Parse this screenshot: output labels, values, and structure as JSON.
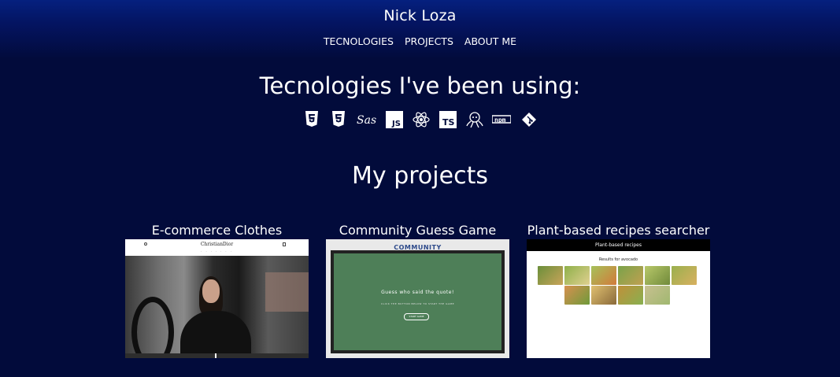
{
  "header": {
    "title": "Nick Loza",
    "nav": [
      "TECNOLOGIES",
      "PROJECTS",
      "ABOUT ME"
    ]
  },
  "technologies": {
    "heading": "Tecnologies I've been using:",
    "icons": [
      "html5-icon",
      "css3-icon",
      "sass-icon",
      "javascript-icon",
      "react-icon",
      "typescript-icon",
      "github-octocat-icon",
      "npm-icon",
      "git-icon"
    ],
    "labels": {
      "sass": "Sass",
      "js": "JS",
      "ts": "TS",
      "npm": "npm"
    }
  },
  "projects": {
    "heading": "My projects",
    "items": [
      {
        "title": "E-commerce Clothes",
        "thumb": {
          "logo": "ChristianDior"
        }
      },
      {
        "title": "Community Guess Game",
        "thumb": {
          "brand": "COMMUNITY",
          "question": "Guess who said the quote!",
          "instruction": "CLICK THE BUTTON BELOW TO START THE GAME",
          "button": "START GAME"
        }
      },
      {
        "title": "Plant-based recipes searcher",
        "thumb": {
          "bar_title": "Plant-based recipes",
          "results": "Results for avocado"
        }
      }
    ]
  },
  "colors": {
    "background": "#020b3b",
    "header_gradient_top": "#05207f",
    "text": "#ffffff",
    "board_green": "#4e7f58"
  }
}
